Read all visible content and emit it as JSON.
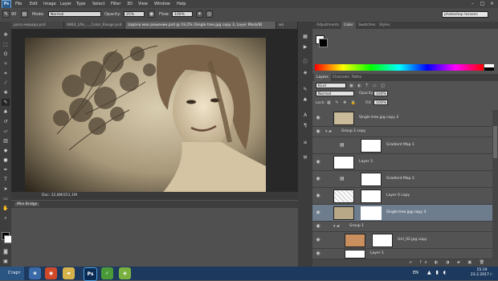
{
  "menubar": {
    "logo": "Ps",
    "items": [
      "File",
      "Edit",
      "Image",
      "Layer",
      "Type",
      "Select",
      "Filter",
      "3D",
      "View",
      "Window",
      "Help"
    ]
  },
  "options": {
    "brush_size": "90",
    "mode_label": "Mode:",
    "mode_value": "Normal",
    "opacity_label": "Opacity:",
    "opacity_value": "25%",
    "flow_label": "Flow:",
    "flow_value": "100%",
    "workspace": "photoshop lessons"
  },
  "tabs": [
    {
      "label": "роса мерида.psd",
      "active": false
    },
    {
      "label": "6864_LIfe_..._Color_Range.psd",
      "active": false
    },
    {
      "label": "задача мое решение.psd @ 19,2% (Single tree.jpg copy 3, Layer Mask/8)",
      "active": true
    },
    {
      "label": "wn",
      "active": false
    }
  ],
  "status": {
    "doc": "Doc: 22,8M/251,1M"
  },
  "minibridge": {
    "title": "Mini Bridge"
  },
  "panels": {
    "top_tabs": [
      "Adjustments",
      "Color",
      "Swatches",
      "Styles"
    ],
    "layers_tabs": [
      "Layers",
      "Channels",
      "Paths"
    ],
    "kind_label": "Kind",
    "blend_mode": "Normal",
    "opacity_label": "Opacity:",
    "opacity_value": "100%",
    "lock_label": "Lock:",
    "fill_label": "Fill:",
    "fill_value": "100%"
  },
  "layers": [
    {
      "name": "Single tree.jpg copy 2",
      "thumb": "tree",
      "mask": false,
      "group": false,
      "selected": false
    },
    {
      "name": "Group 2 copy",
      "thumb": "folder",
      "mask": false,
      "group": true,
      "selected": false
    },
    {
      "name": "Gradient Map 1",
      "thumb": "adjust",
      "mask": true,
      "group": false,
      "selected": false
    },
    {
      "name": "Layer 3",
      "thumb": "white",
      "mask": false,
      "group": false,
      "selected": false
    },
    {
      "name": "Gradient Map 2",
      "thumb": "adjust",
      "mask": true,
      "group": false,
      "selected": false
    },
    {
      "name": "Layer 0 copy",
      "thumb": "transparent",
      "mask": true,
      "group": false,
      "selected": false
    },
    {
      "name": "Single tree.jpg copy 3",
      "thumb": "tree",
      "mask": true,
      "group": false,
      "selected": true
    },
    {
      "name": "Group 1",
      "thumb": "folder",
      "mask": false,
      "group": true,
      "selected": false
    },
    {
      "name": "Girl_02.jpg copy",
      "thumb": "girl",
      "mask": true,
      "group": false,
      "selected": false
    },
    {
      "name": "Layer 1",
      "thumb": "white",
      "mask": false,
      "group": false,
      "selected": false
    }
  ],
  "taskbar": {
    "start": "Старт",
    "lang": "EN",
    "time": "15:19",
    "date": "23.2.2017 г."
  },
  "colors": {
    "selected_layer": "#6d7d8e",
    "taskbar": "#1d3a5e"
  }
}
